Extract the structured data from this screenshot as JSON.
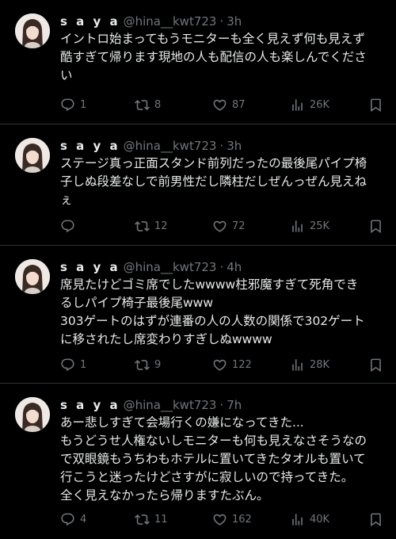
{
  "tweets": [
    {
      "name": "s a y a",
      "handle": "@hina__kwt723",
      "separator": "·",
      "time": "3h",
      "lines": [
        "イントロ始まってもうモニターも全く見えず何も見えず",
        "酷すぎて帰ります現地の人も配信の人も楽しんでくださ",
        "い"
      ],
      "stats": {
        "replies": "1",
        "retweets": "8",
        "likes": "87",
        "views": "26K"
      }
    },
    {
      "name": "s a y a",
      "handle": "@hina__kwt723",
      "separator": "·",
      "time": "3h",
      "lines": [
        "ステージ真っ正面スタンド前列だったの最後尾パイプ椅",
        "子しぬ段差なしで前男性だし隣柱だしぜんっぜん見えね",
        "ぇ"
      ],
      "stats": {
        "replies": "",
        "retweets": "12",
        "likes": "72",
        "views": "25K"
      }
    },
    {
      "name": "s a y a",
      "handle": "@hina__kwt723",
      "separator": "·",
      "time": "4h",
      "lines": [
        "席見たけどゴミ席でしたwwww柱邪魔すぎて死角でき",
        "るしパイプ椅子最後尾www",
        "303ゲートのはずが連番の人の人数の関係で302ゲート",
        "に移されたし席変わりすぎしぬwwww"
      ],
      "stats": {
        "replies": "1",
        "retweets": "9",
        "likes": "122",
        "views": "28K"
      }
    },
    {
      "name": "s a y a",
      "handle": "@hina__kwt723",
      "separator": "·",
      "time": "7h",
      "lines": [
        "あー悲しすぎて会場行くの嫌になってきた...",
        "もうどうせ人権ないしモニターも何も見えなさそうなの",
        "で双眼鏡もうちわもホテルに置いてきたタオルも置いて",
        "行こうと迷ったけどさすがに寂しいので持ってきた。",
        "全く見えなかったら帰りますたぶん。"
      ],
      "stats": {
        "replies": "4",
        "retweets": "11",
        "likes": "162",
        "views": "40K"
      }
    }
  ]
}
